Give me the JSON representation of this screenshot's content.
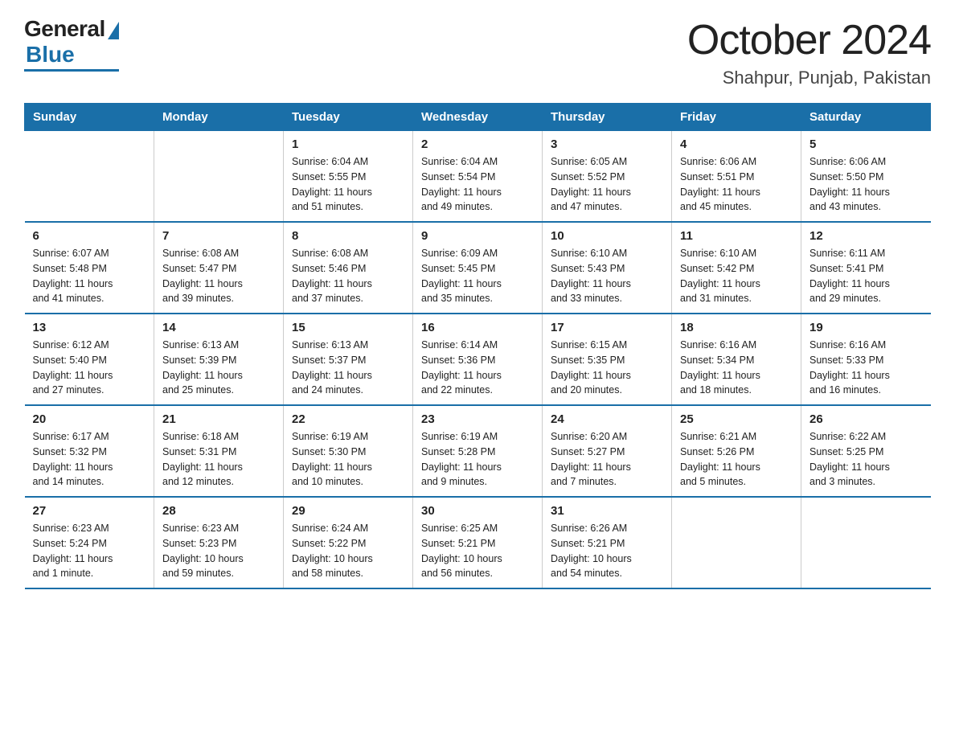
{
  "logo": {
    "general": "General",
    "blue": "Blue"
  },
  "title": "October 2024",
  "subtitle": "Shahpur, Punjab, Pakistan",
  "headers": [
    "Sunday",
    "Monday",
    "Tuesday",
    "Wednesday",
    "Thursday",
    "Friday",
    "Saturday"
  ],
  "weeks": [
    [
      {
        "day": "",
        "info": ""
      },
      {
        "day": "",
        "info": ""
      },
      {
        "day": "1",
        "info": "Sunrise: 6:04 AM\nSunset: 5:55 PM\nDaylight: 11 hours\nand 51 minutes."
      },
      {
        "day": "2",
        "info": "Sunrise: 6:04 AM\nSunset: 5:54 PM\nDaylight: 11 hours\nand 49 minutes."
      },
      {
        "day": "3",
        "info": "Sunrise: 6:05 AM\nSunset: 5:52 PM\nDaylight: 11 hours\nand 47 minutes."
      },
      {
        "day": "4",
        "info": "Sunrise: 6:06 AM\nSunset: 5:51 PM\nDaylight: 11 hours\nand 45 minutes."
      },
      {
        "day": "5",
        "info": "Sunrise: 6:06 AM\nSunset: 5:50 PM\nDaylight: 11 hours\nand 43 minutes."
      }
    ],
    [
      {
        "day": "6",
        "info": "Sunrise: 6:07 AM\nSunset: 5:48 PM\nDaylight: 11 hours\nand 41 minutes."
      },
      {
        "day": "7",
        "info": "Sunrise: 6:08 AM\nSunset: 5:47 PM\nDaylight: 11 hours\nand 39 minutes."
      },
      {
        "day": "8",
        "info": "Sunrise: 6:08 AM\nSunset: 5:46 PM\nDaylight: 11 hours\nand 37 minutes."
      },
      {
        "day": "9",
        "info": "Sunrise: 6:09 AM\nSunset: 5:45 PM\nDaylight: 11 hours\nand 35 minutes."
      },
      {
        "day": "10",
        "info": "Sunrise: 6:10 AM\nSunset: 5:43 PM\nDaylight: 11 hours\nand 33 minutes."
      },
      {
        "day": "11",
        "info": "Sunrise: 6:10 AM\nSunset: 5:42 PM\nDaylight: 11 hours\nand 31 minutes."
      },
      {
        "day": "12",
        "info": "Sunrise: 6:11 AM\nSunset: 5:41 PM\nDaylight: 11 hours\nand 29 minutes."
      }
    ],
    [
      {
        "day": "13",
        "info": "Sunrise: 6:12 AM\nSunset: 5:40 PM\nDaylight: 11 hours\nand 27 minutes."
      },
      {
        "day": "14",
        "info": "Sunrise: 6:13 AM\nSunset: 5:39 PM\nDaylight: 11 hours\nand 25 minutes."
      },
      {
        "day": "15",
        "info": "Sunrise: 6:13 AM\nSunset: 5:37 PM\nDaylight: 11 hours\nand 24 minutes."
      },
      {
        "day": "16",
        "info": "Sunrise: 6:14 AM\nSunset: 5:36 PM\nDaylight: 11 hours\nand 22 minutes."
      },
      {
        "day": "17",
        "info": "Sunrise: 6:15 AM\nSunset: 5:35 PM\nDaylight: 11 hours\nand 20 minutes."
      },
      {
        "day": "18",
        "info": "Sunrise: 6:16 AM\nSunset: 5:34 PM\nDaylight: 11 hours\nand 18 minutes."
      },
      {
        "day": "19",
        "info": "Sunrise: 6:16 AM\nSunset: 5:33 PM\nDaylight: 11 hours\nand 16 minutes."
      }
    ],
    [
      {
        "day": "20",
        "info": "Sunrise: 6:17 AM\nSunset: 5:32 PM\nDaylight: 11 hours\nand 14 minutes."
      },
      {
        "day": "21",
        "info": "Sunrise: 6:18 AM\nSunset: 5:31 PM\nDaylight: 11 hours\nand 12 minutes."
      },
      {
        "day": "22",
        "info": "Sunrise: 6:19 AM\nSunset: 5:30 PM\nDaylight: 11 hours\nand 10 minutes."
      },
      {
        "day": "23",
        "info": "Sunrise: 6:19 AM\nSunset: 5:28 PM\nDaylight: 11 hours\nand 9 minutes."
      },
      {
        "day": "24",
        "info": "Sunrise: 6:20 AM\nSunset: 5:27 PM\nDaylight: 11 hours\nand 7 minutes."
      },
      {
        "day": "25",
        "info": "Sunrise: 6:21 AM\nSunset: 5:26 PM\nDaylight: 11 hours\nand 5 minutes."
      },
      {
        "day": "26",
        "info": "Sunrise: 6:22 AM\nSunset: 5:25 PM\nDaylight: 11 hours\nand 3 minutes."
      }
    ],
    [
      {
        "day": "27",
        "info": "Sunrise: 6:23 AM\nSunset: 5:24 PM\nDaylight: 11 hours\nand 1 minute."
      },
      {
        "day": "28",
        "info": "Sunrise: 6:23 AM\nSunset: 5:23 PM\nDaylight: 10 hours\nand 59 minutes."
      },
      {
        "day": "29",
        "info": "Sunrise: 6:24 AM\nSunset: 5:22 PM\nDaylight: 10 hours\nand 58 minutes."
      },
      {
        "day": "30",
        "info": "Sunrise: 6:25 AM\nSunset: 5:21 PM\nDaylight: 10 hours\nand 56 minutes."
      },
      {
        "day": "31",
        "info": "Sunrise: 6:26 AM\nSunset: 5:21 PM\nDaylight: 10 hours\nand 54 minutes."
      },
      {
        "day": "",
        "info": ""
      },
      {
        "day": "",
        "info": ""
      }
    ]
  ]
}
